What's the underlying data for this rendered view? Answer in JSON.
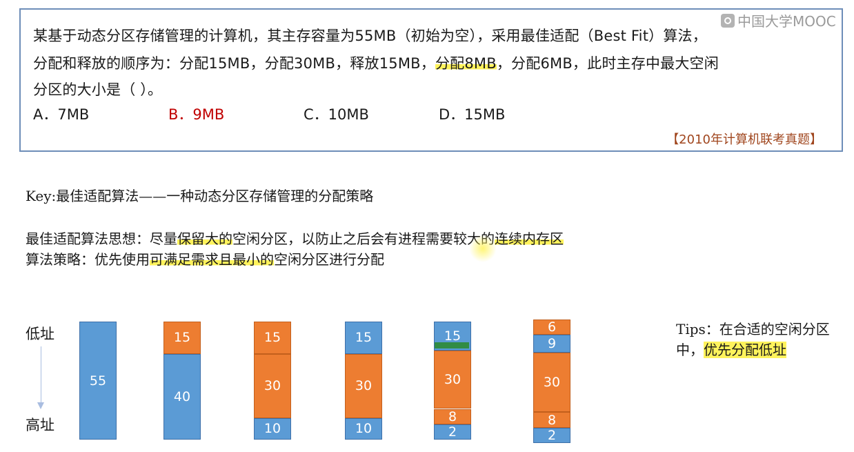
{
  "watermark": "中国大学MOOC",
  "question": {
    "line1": "某基于动态分区存储管理的计算机，其主存容量为55MB（初始为空），采用最佳适配（Best Fit）算法，",
    "line2_a": "分配和释放的顺序为：分配15MB，分配30MB，释放15MB，",
    "line2_b": "分配8MB",
    "line2_c": "，分配6MB，此时主存中最大空闲",
    "line3": "分区的大小是（    ）。",
    "options": [
      "A．7MB",
      "B．9MB",
      "C．10MB",
      "D．15MB"
    ],
    "source": "【2010年计算机联考真题】"
  },
  "key": "Key:最佳适配算法——一种动态分区存储管理的分配策略",
  "idea": {
    "prefix": "最佳适配算法思想：尽量",
    "hl1": "保留大的",
    "mid": "空闲分区，以防止之后会有进程需要较大的",
    "hl2": "连续内存区"
  },
  "strategy": {
    "prefix": "算法策略：优先使用",
    "hl1": "可满足需求且",
    "hl2": "最小的",
    "suffix": "空闲分区进行分配"
  },
  "low_addr": "低址",
  "high_addr": "高址",
  "tips": {
    "part1": "Tips：在合适的空闲分区中，",
    "part2": "优先分配低址"
  },
  "colors": {
    "free": "#5b9bd5",
    "allocated": "#ed7d31",
    "highlight": "#fff35c",
    "answer": "#c00000"
  },
  "memory_states": [
    [
      {
        "size": 55,
        "label": "55",
        "state": "free"
      }
    ],
    [
      {
        "size": 15,
        "label": "15",
        "state": "allocated"
      },
      {
        "size": 40,
        "label": "40",
        "state": "free"
      }
    ],
    [
      {
        "size": 15,
        "label": "15",
        "state": "allocated"
      },
      {
        "size": 30,
        "label": "30",
        "state": "allocated"
      },
      {
        "size": 10,
        "label": "10",
        "state": "free"
      }
    ],
    [
      {
        "size": 15,
        "label": "15",
        "state": "free"
      },
      {
        "size": 30,
        "label": "30",
        "state": "allocated"
      },
      {
        "size": 10,
        "label": "10",
        "state": "free"
      }
    ],
    [
      {
        "size": 15,
        "label": "15",
        "state": "free"
      },
      {
        "size": 30,
        "label": "30",
        "state": "allocated"
      },
      {
        "size": 8,
        "label": "8",
        "state": "allocated"
      },
      {
        "size": 2,
        "label": "2",
        "state": "free"
      }
    ],
    [
      {
        "size": 6,
        "label": "6",
        "state": "allocated"
      },
      {
        "size": 9,
        "label": "9",
        "state": "free"
      },
      {
        "size": 30,
        "label": "30",
        "state": "allocated"
      },
      {
        "size": 8,
        "label": "8",
        "state": "allocated"
      },
      {
        "size": 2,
        "label": "2",
        "state": "free"
      }
    ]
  ]
}
